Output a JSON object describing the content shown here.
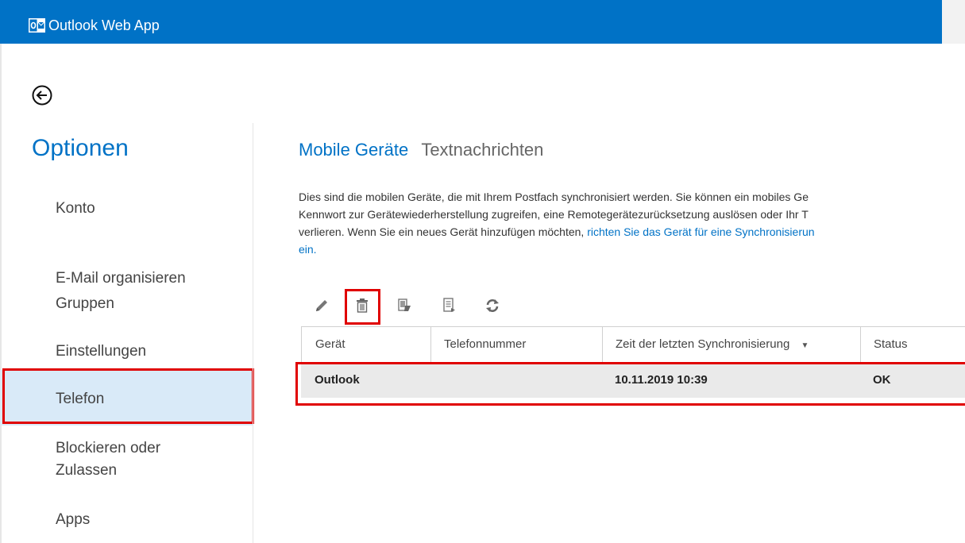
{
  "app": {
    "title": "Outlook Web App",
    "logo_icon": "outlook-logo-icon"
  },
  "nav": {
    "back_icon": "back-arrow-icon",
    "title": "Optionen",
    "items": [
      {
        "label": "Konto"
      },
      {
        "label": "E-Mail organisieren"
      },
      {
        "label": "Gruppen"
      },
      {
        "label": "Einstellungen"
      },
      {
        "label": "Telefon",
        "selected": true
      },
      {
        "label": "Blockieren oder",
        "label2": "Zulassen"
      },
      {
        "label": "Apps"
      }
    ]
  },
  "main": {
    "tabs": [
      {
        "label": "Mobile Geräte",
        "active": true
      },
      {
        "label": "Textnachrichten",
        "active": false
      }
    ],
    "description": {
      "line1": "Dies sind die mobilen Geräte, die mit Ihrem Postfach synchronisiert werden. Sie können ein mobiles Ge",
      "line2": "Kennwort zur Gerätewiederherstellung zugreifen, eine Remotegerätezurücksetzung auslösen oder Ihr T",
      "line3_text": "verlieren. Wenn Sie ein neues Gerät hinzufügen möchten, ",
      "line3_link": "richten Sie das Gerät für eine Synchronisierun",
      "line4_link": "ein."
    },
    "toolbar": {
      "icons": [
        "edit-pencil-icon",
        "delete-trash-icon",
        "wipe-device-icon",
        "recovery-password-icon",
        "refresh-icon"
      ]
    },
    "table": {
      "columns": [
        "Gerät",
        "Telefonnummer",
        "Zeit der letzten Synchronisierung",
        "Status"
      ],
      "sort_indicator": "▼",
      "rows": [
        {
          "device": "Outlook",
          "phone": "",
          "last_sync": "10.11.2019 10:39",
          "status": "OK"
        }
      ]
    }
  },
  "colors": {
    "accent": "#0072c6",
    "highlight": "#e00000",
    "selected_bg": "#d9eaf8"
  }
}
